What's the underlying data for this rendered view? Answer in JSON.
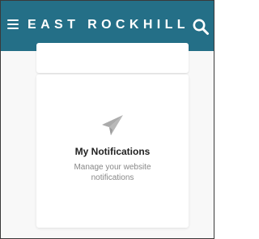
{
  "header": {
    "title": "EAST ROCKHILL",
    "menu_icon": "menu-icon",
    "search_icon": "search-icon",
    "background_color": "#246f87"
  },
  "main": {
    "card": {
      "icon": "paper-plane-icon",
      "title": "My Notifications",
      "description": "Manage your website notifications"
    }
  }
}
